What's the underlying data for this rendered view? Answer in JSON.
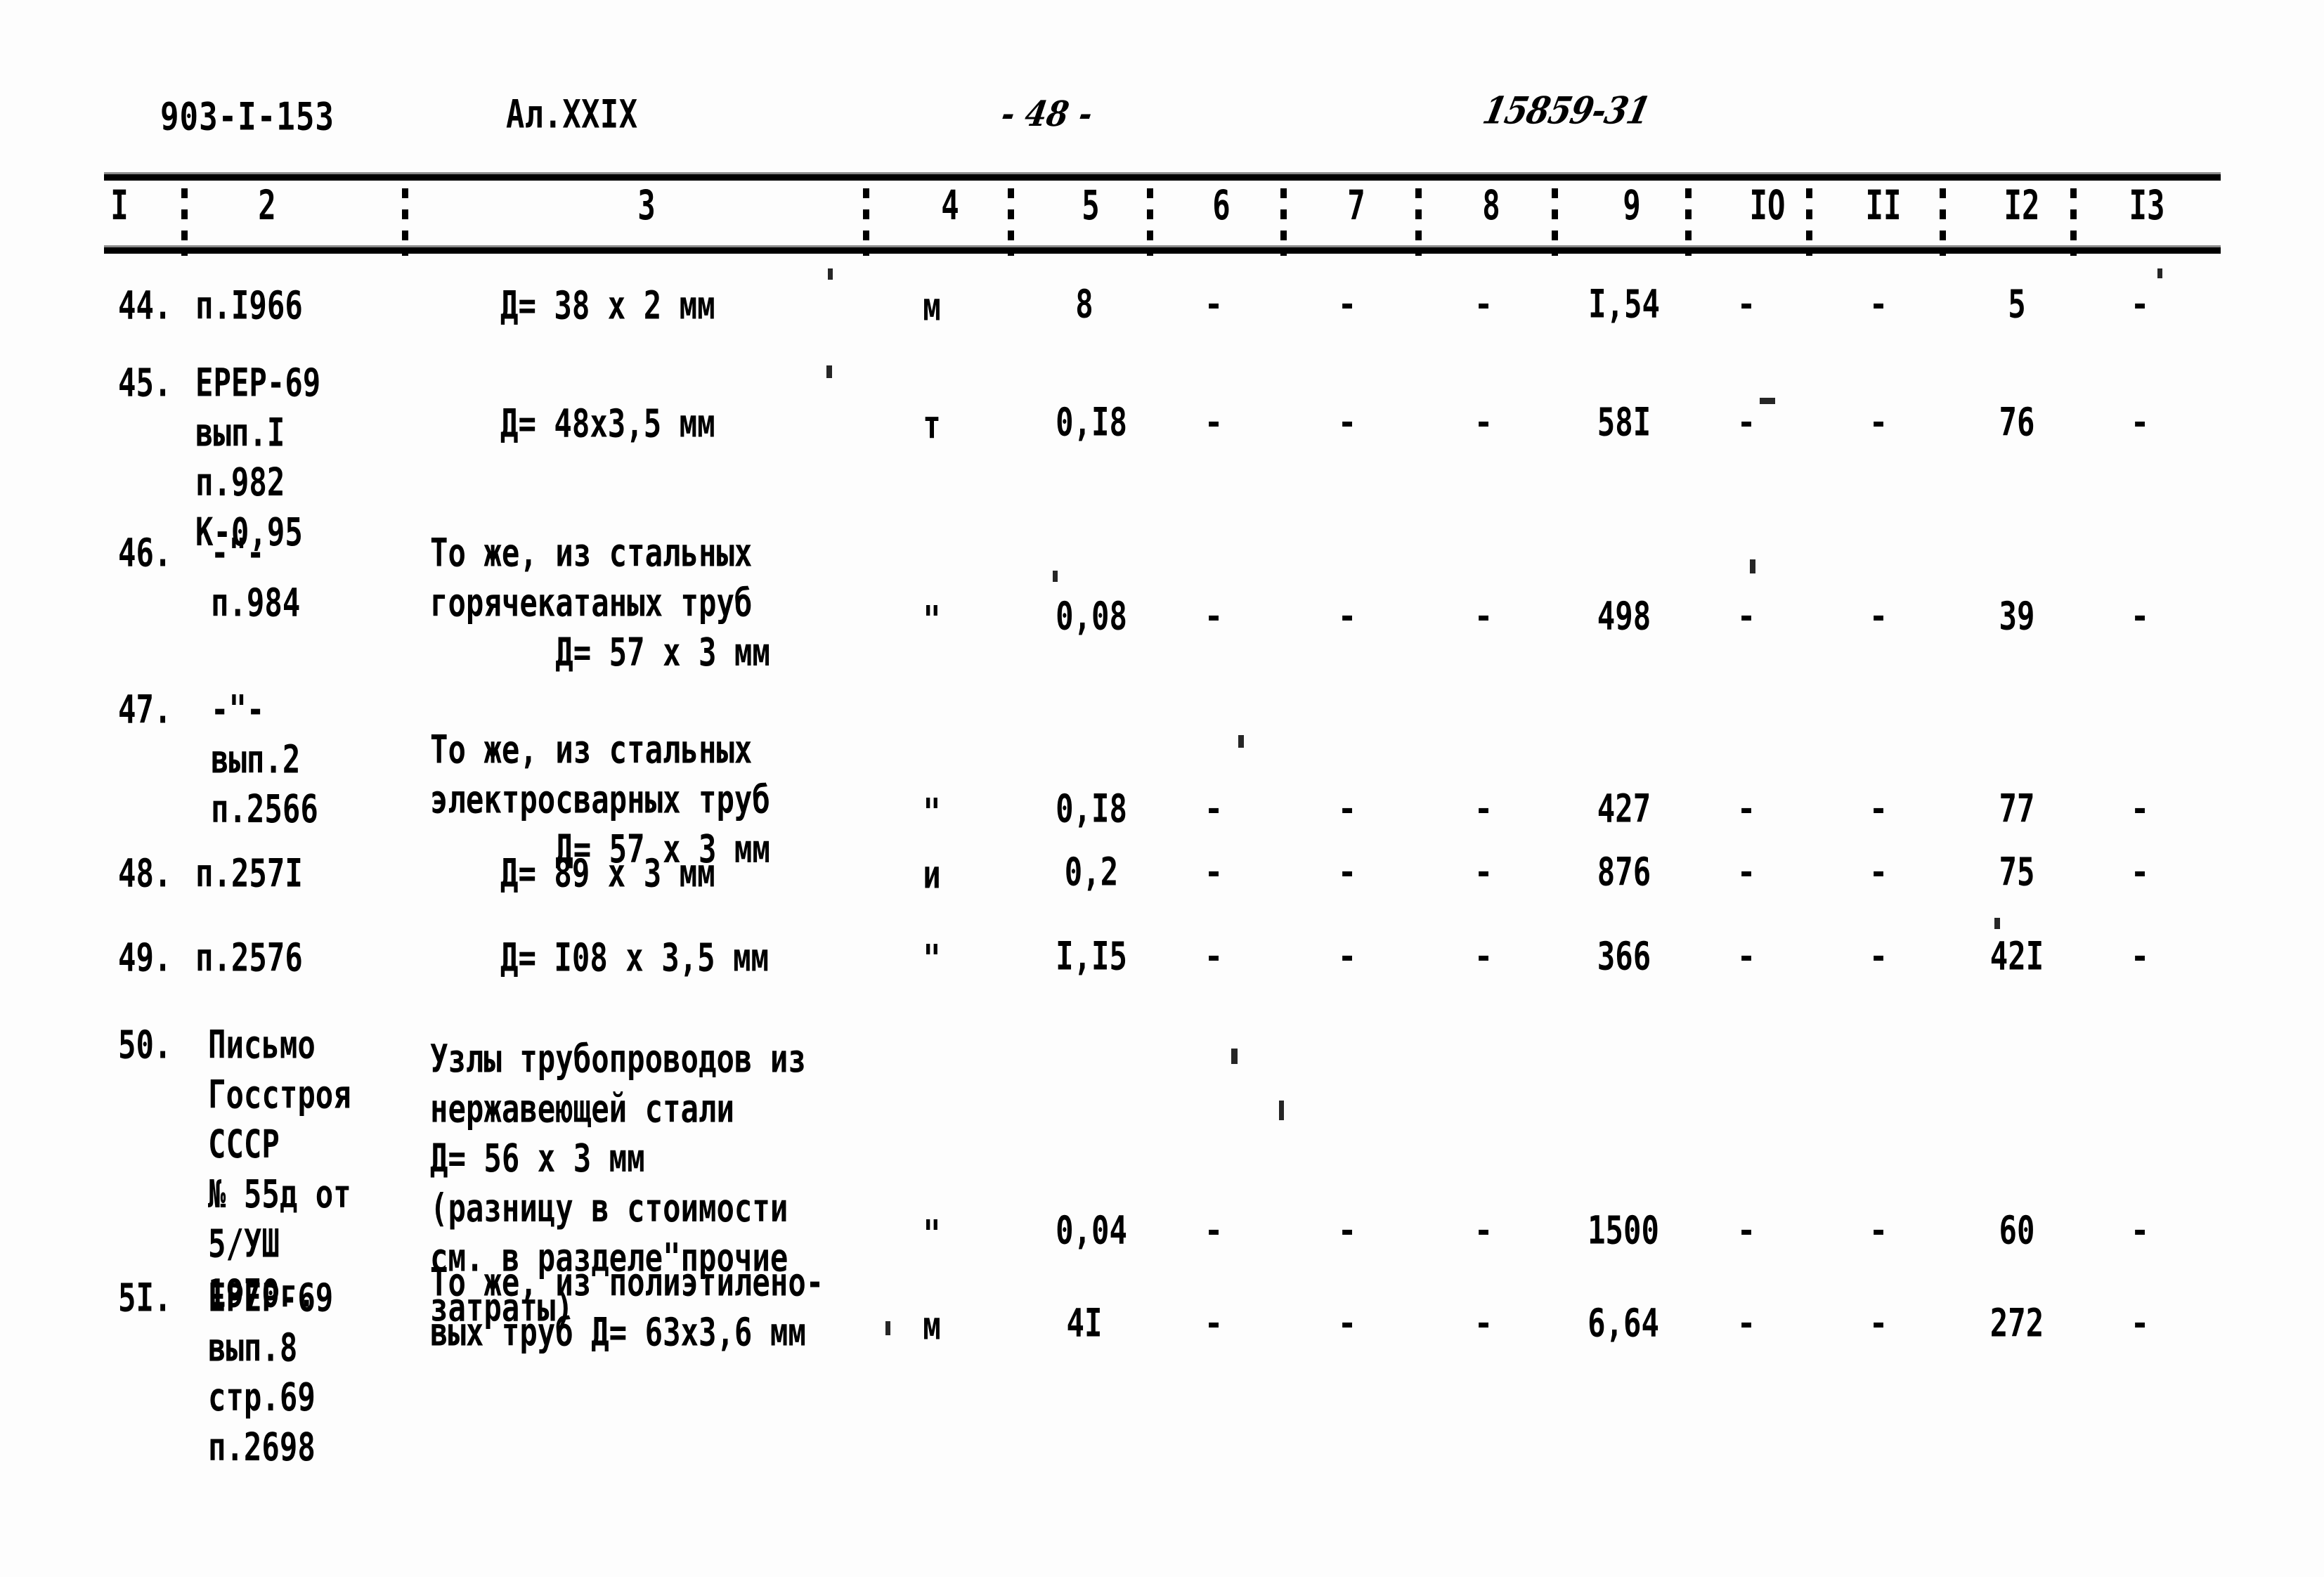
{
  "header": {
    "doc_code": "903-I-153",
    "album": "Ал.XXIX",
    "page_number": "- 48 -",
    "archive_stamp": "15859-31"
  },
  "table": {
    "column_headers": [
      "I",
      "2",
      "3",
      "4",
      "5",
      "6",
      "7",
      "8",
      "9",
      "IO",
      "II",
      "I2",
      "I3"
    ],
    "rows": [
      {
        "num": "44.",
        "source": "п.I966",
        "description": "Д= 38 х 2 мм",
        "unit": "м",
        "c5": "8",
        "c6": "-",
        "c7": "-",
        "c8": "-",
        "c9": "I,54",
        "c10": "-",
        "c11": "-",
        "c12": "5",
        "c13": "-"
      },
      {
        "num": "45.",
        "source": "ЕРЕР-69\nвып.I\nп.982\nК-0,95",
        "description": "Д= 48х3,5 мм",
        "unit": "т",
        "c5": "0,I8",
        "c6": "-",
        "c7": "-",
        "c8": "-",
        "c9": "58I",
        "c10": "-",
        "c11": "-",
        "c12": "76",
        "c13": "-"
      },
      {
        "num": "46.",
        "source": "-\"-\nп.984",
        "description": "То же, из стальных\nгорячекатаных труб\n       Д= 57 х 3 мм",
        "unit": "\"",
        "c5": "0,08",
        "c6": "-",
        "c7": "-",
        "c8": "-",
        "c9": "498",
        "c10": "-",
        "c11": "-",
        "c12": "39",
        "c13": "-"
      },
      {
        "num": "47.",
        "source": "-\"-\nвып.2\nп.2566",
        "description": "То же, из стальных\nэлектросварных труб\n       Д= 57 х 3 мм",
        "unit": "\"",
        "c5": "0,I8",
        "c6": "-",
        "c7": "-",
        "c8": "-",
        "c9": "427",
        "c10": "-",
        "c11": "-",
        "c12": "77",
        "c13": "-"
      },
      {
        "num": "48.",
        "source": "п.257I",
        "description": "Д= 89 х 3 мм",
        "unit": "и",
        "c5": "0,2",
        "c6": "-",
        "c7": "-",
        "c8": "-",
        "c9": "876",
        "c10": "-",
        "c11": "-",
        "c12": "75",
        "c13": "-"
      },
      {
        "num": "49.",
        "source": "п.2576",
        "description": "Д= I08 х 3,5 мм",
        "unit": "\"",
        "c5": "I,I5",
        "c6": "-",
        "c7": "-",
        "c8": "-",
        "c9": "366",
        "c10": "-",
        "c11": "-",
        "c12": "42I",
        "c13": "-"
      },
      {
        "num": "50.",
        "source": "Письмо\nГосстроя\nСССР\n№ 55д от\n5/УШ\n1970г.",
        "description": "Узлы трубопроводов из\nнержавеющей стали\nД= 56 х 3 мм\n(разницу в стоимости\nсм. в разделе\"прочие\nзатраты)",
        "unit": "\"",
        "c5": "0,04",
        "c6": "-",
        "c7": "-",
        "c8": "-",
        "c9": "1500",
        "c10": "-",
        "c11": "-",
        "c12": "60",
        "c13": "-"
      },
      {
        "num": "5I.",
        "source": "ЕРЕР-69\nвып.8\nстр.69\nп.2698",
        "description": "То же, из полиэтилено-\nвых труб Д= 63х3,6 мм",
        "unit": "м",
        "c5": "4I",
        "c6": "-",
        "c7": "-",
        "c8": "-",
        "c9": "6,64",
        "c10": "-",
        "c11": "-",
        "c12": "272",
        "c13": "-"
      }
    ]
  }
}
